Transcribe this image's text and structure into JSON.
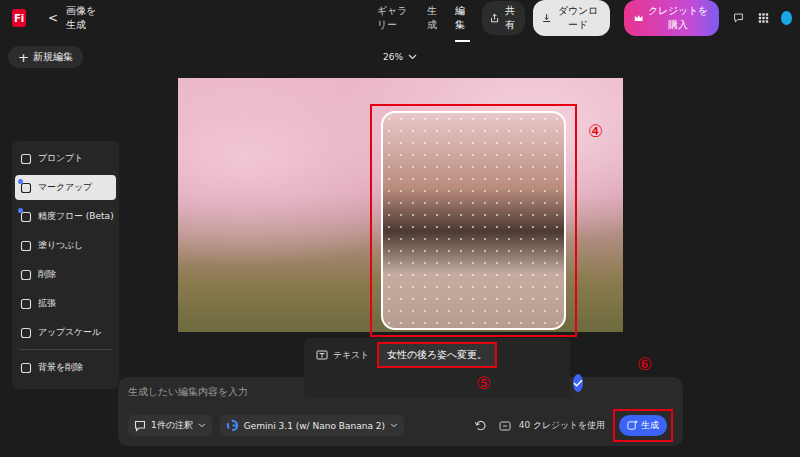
{
  "app": {
    "logo": "Fi",
    "back": "<",
    "title": "画像を生成"
  },
  "nav": [
    {
      "label": "ギャラリー",
      "selected": false
    },
    {
      "label": "生成",
      "selected": false
    },
    {
      "label": "編集",
      "selected": true
    }
  ],
  "actions": {
    "share": "共有",
    "download": "ダウンロード",
    "buy": "クレジットを購入"
  },
  "toolbar": {
    "new_icon": "+",
    "new_edit": "新規編集",
    "zoom": "26%"
  },
  "canvas": {
    "marker": "④"
  },
  "sidebar": {
    "groups": [
      [
        {
          "label": "プロンプト",
          "selected": false,
          "badge": false
        },
        {
          "label": "マークアップ",
          "selected": true,
          "badge": true
        },
        {
          "label": "精度フロー (Beta)",
          "selected": false,
          "badge": true
        },
        {
          "label": "塗りつぶし",
          "selected": false,
          "badge": false
        },
        {
          "label": "削除",
          "selected": false,
          "badge": false
        },
        {
          "label": "拡張",
          "selected": false,
          "badge": false
        },
        {
          "label": "アップスケール",
          "selected": false,
          "badge": false
        }
      ],
      [
        {
          "label": "背景を削除",
          "selected": false,
          "badge": false
        }
      ]
    ]
  },
  "note_popup": {
    "mode": "テキスト",
    "text": "女性の後ろ姿へ変更。",
    "marker": "⑤"
  },
  "prompt": {
    "placeholder": "生成したい編集内容を入力",
    "notes": "1件の注釈",
    "model": "Gemini 3.1 (w/ Nano Banana 2)",
    "credits": "40 クレジットを使用",
    "generate": "生成",
    "marker": "⑥"
  }
}
